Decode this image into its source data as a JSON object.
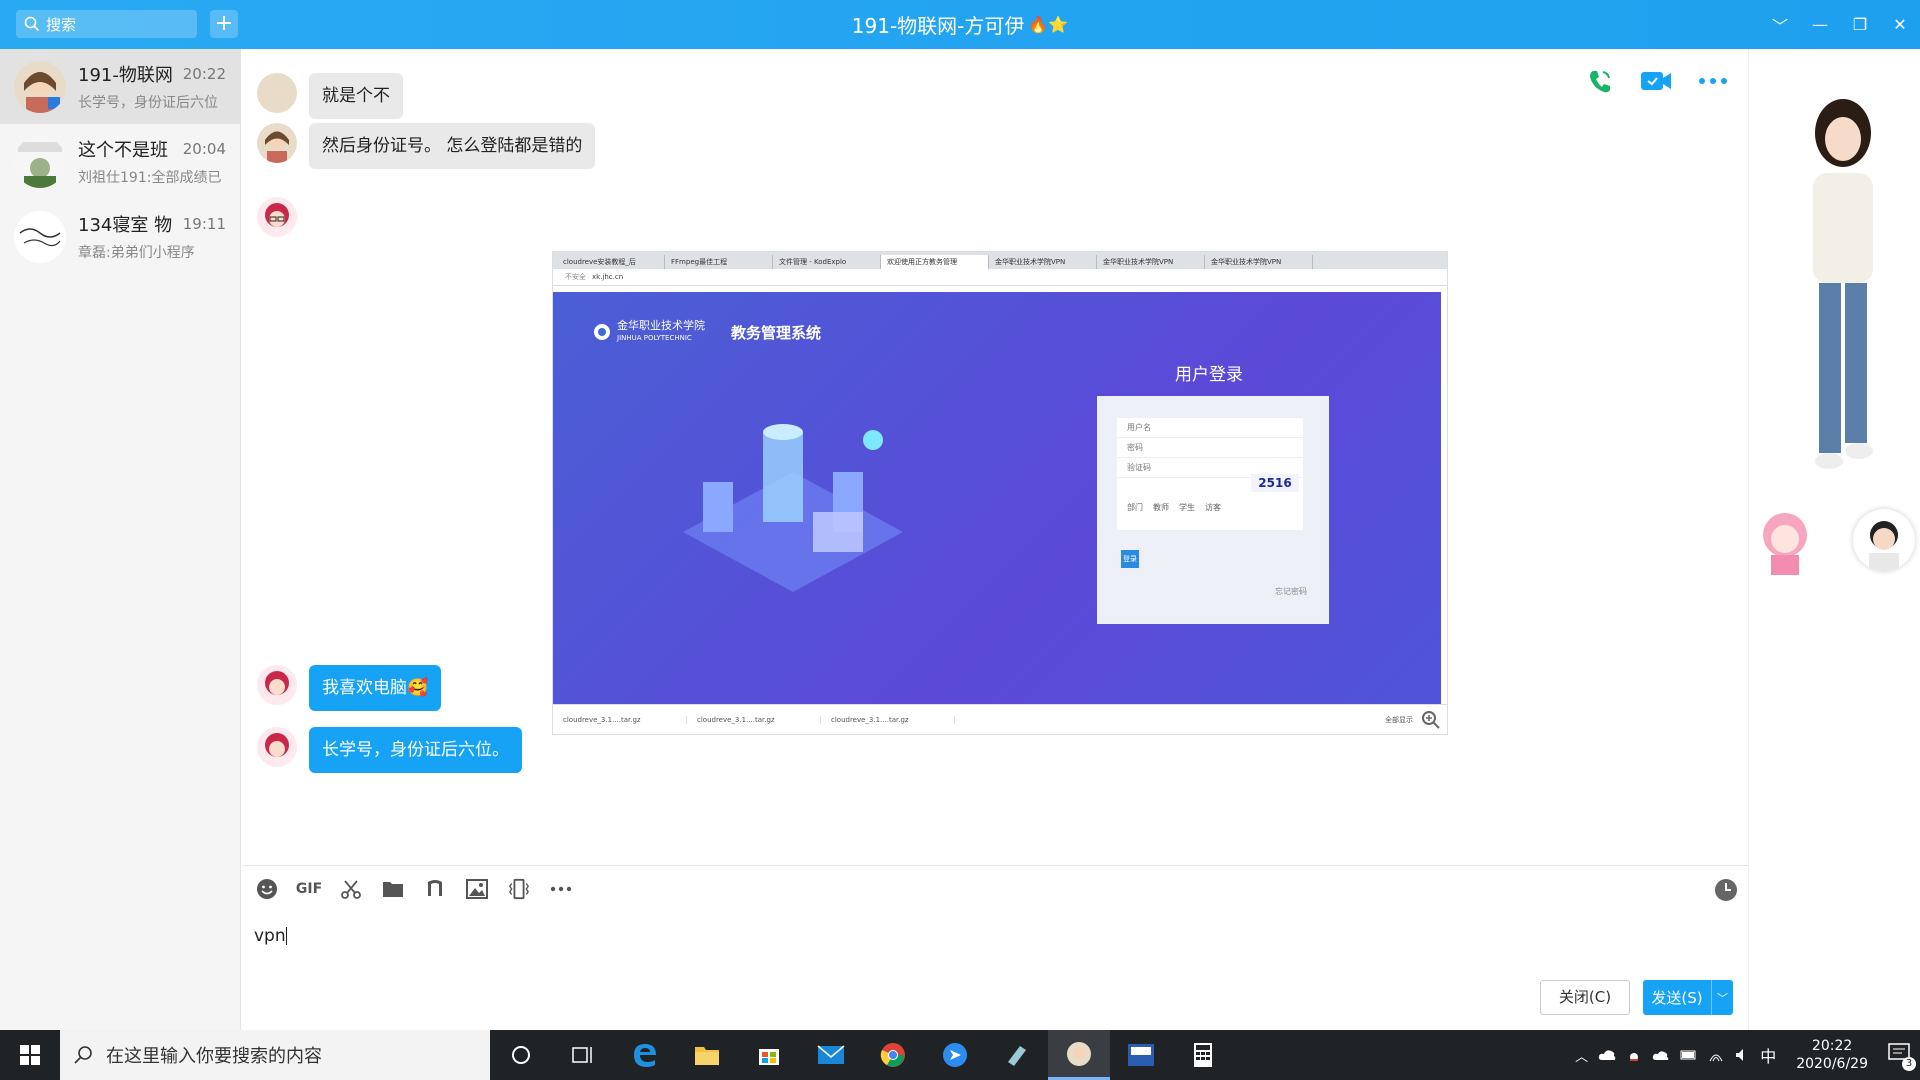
{
  "titlebar": {
    "search_placeholder": "搜索",
    "add_label": "+",
    "title": "191-物联网-方可伊",
    "title_emoji": "🔥⭐",
    "controls": [
      "﹀",
      "—",
      "❐",
      "✕"
    ]
  },
  "sidebar": {
    "items": [
      {
        "name": "191-物联网",
        "time": "20:22",
        "preview": "长学号，身份证后六位",
        "active": true
      },
      {
        "name": "这个不是班",
        "time": "20:04",
        "preview": "刘祖仕191:全部成绩已",
        "active": false
      },
      {
        "name": "134寝室 物",
        "time": "19:11",
        "preview": "章磊:弟弟们小程序",
        "active": false
      }
    ]
  },
  "messages": {
    "m0": "就是个不",
    "m1": "然后身份证号。 怎么登陆都是错的",
    "m2": "我喜欢电脑",
    "m2_emoji": "🥰",
    "m3": "长学号，身份证后六位。"
  },
  "screenshot": {
    "tabs": [
      "cloudreve安装教程_后",
      "FFmpeg最佳工程",
      "文件管理 - KodExplo",
      "欢迎使用正方教务管理",
      "金华职业技术学院VPN",
      "金华职业技术学院VPN",
      "金华职业技术学院VPN"
    ],
    "address_security": "不安全",
    "address": "xk.jhc.cn",
    "school_name_cn": "金华职业技术学院",
    "school_name_en": "JINHUA POLYTECHNIC",
    "system_name": "教务管理系统",
    "login_title": "用户登录",
    "username_placeholder": "用户名",
    "password_placeholder": "密码",
    "captcha_placeholder": "验证码",
    "captcha_value": "2516",
    "roles": [
      "部门",
      "教师",
      "学生",
      "访客"
    ],
    "login_button": "登录",
    "forgot": "忘记密码",
    "downloads": [
      "cloudreve_3.1....tar.gz",
      "cloudreve_3.1....tar.gz",
      "cloudreve_3.1....tar.gz"
    ],
    "show_all": "全部显示"
  },
  "composer": {
    "tools": [
      "emoji-icon",
      "gif-icon",
      "scissors-icon",
      "folder-icon",
      "music-icon",
      "image-icon",
      "screen-shake-icon",
      "more-icon"
    ],
    "gif_label": "GIF",
    "input_value": "vpn",
    "close_button": "关闭(C)",
    "send_button": "发送(S)"
  },
  "taskbar": {
    "search_placeholder": "在这里输入你要搜索的内容",
    "time": "20:22",
    "date": "2020/6/29",
    "ime": "中",
    "notification_count": "3"
  },
  "colors": {
    "accent": "#17a3f5",
    "titlebar": "#22a4f1",
    "taskbar": "#202326"
  }
}
